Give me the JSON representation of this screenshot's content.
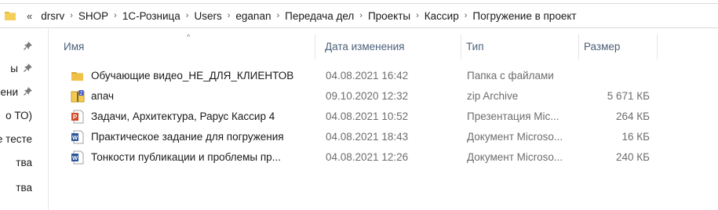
{
  "address_bar": {
    "overflow": "«",
    "crumbs": [
      "drsrv",
      "SHOP",
      "1С-Розница",
      "Users",
      "eganan",
      "Передача дел",
      "Проекты",
      "Кассир",
      "Погружение в проект"
    ],
    "separator": "›"
  },
  "nav_pane": {
    "items": [
      {
        "label": "",
        "pinned": true
      },
      {
        "label": "ы",
        "pinned": true
      },
      {
        "label": "ени",
        "pinned": true
      },
      {
        "label": "о ТО)",
        "pinned": false
      },
      {
        "label": "е тесте",
        "pinned": false
      },
      {
        "label": "тва",
        "pinned": false
      },
      {
        "label": "тва",
        "pinned": false
      }
    ],
    "pin_glyph": "📌"
  },
  "columns": {
    "name": "Имя",
    "date": "Дата изменения",
    "type": "Тип",
    "size": "Размер",
    "sort_indicator": "^"
  },
  "files": [
    {
      "icon": "folder-icon",
      "name": "Обучающие видео_НЕ_ДЛЯ_КЛИЕНТОВ",
      "date": "04.08.2021 16:42",
      "type": "Папка с файлами",
      "size": ""
    },
    {
      "icon": "zip-archive-icon",
      "name": "апач",
      "date": "09.10.2020 12:32",
      "type": "zip Archive",
      "size": "5 671 КБ"
    },
    {
      "icon": "powerpoint-icon",
      "name": "Задачи, Архитектура,  Рарус Кассир 4",
      "date": "04.08.2021 10:52",
      "type": "Презентация Mic...",
      "size": "264 КБ"
    },
    {
      "icon": "word-document-icon",
      "name": "Практическое задание для погружения",
      "date": "04.08.2021 18:43",
      "type": "Документ Microso...",
      "size": "16 КБ"
    },
    {
      "icon": "word-document-icon",
      "name": "Тонкости публикации и проблемы пр...",
      "date": "04.08.2021 12:26",
      "type": "Документ Microso...",
      "size": "240 КБ"
    }
  ],
  "colors": {
    "folder": "#f0c048",
    "header_text": "#4c607a",
    "secondary_text": "#6d6d6d",
    "word_blue": "#2b579a",
    "ppt_orange": "#d24726"
  }
}
